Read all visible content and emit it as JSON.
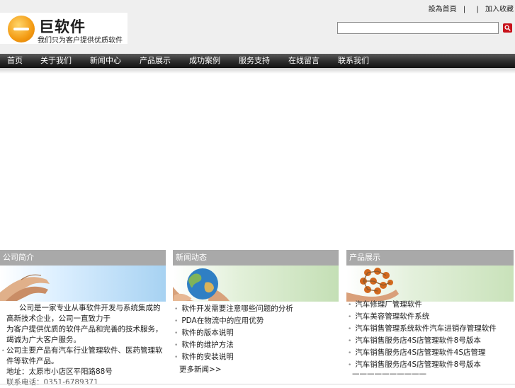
{
  "top_links": [
    "設為首頁",
    "|",
    "|",
    "加入收藏"
  ],
  "logo": {
    "name": "巨软件",
    "slogan": "我们只为客户提供优质软件"
  },
  "search": {
    "value": "",
    "button_icon": "search-icon"
  },
  "nav": [
    "首页",
    "关于我们",
    "新闻中心",
    "产品展示",
    "成功案例",
    "服务支持",
    "在线留言",
    "联系我们"
  ],
  "panels": {
    "about": {
      "title": "公司简介",
      "lines": [
        "公司是一家专业从事软件开发与系统集成的高新技术企业，公司一直致力于",
        "为客户提供优质的软件产品和完善的技术服务，竭诚为广大客户服务。",
        "公司主要产品有汽车行业管理软件、医药管理软件等软件产品。",
        "地址：太原市小店区平阳路88号",
        "联系电话：0351-6789371"
      ]
    },
    "news": {
      "title": "新闻动态",
      "items": [
        "软件开发需要注意哪些问题的分析",
        "PDA在物流中的应用优势",
        "软件的版本说明",
        "软件的维护方法",
        "软件的安装说明",
        "更多新闻>>"
      ]
    },
    "products": {
      "title": "产品展示",
      "items": [
        "汽车修理厂管理软件",
        "汽车美容管理软件系统",
        "汽车销售管理系统软件汽车进销存管理软件",
        "汽车销售服务店4S店管理软件8号版本",
        "汽车销售服务店4S店管理软件4S店管理",
        "汽车销售服务店4S店管理软件8号版本",
        "——————————"
      ]
    }
  },
  "colors": {
    "header_bg": "#efefef",
    "nav_bg": "#2a2a2a",
    "panel_head_bg": "#a9a9a9",
    "accent": "#f39a12",
    "search_button": "#c8121b"
  }
}
